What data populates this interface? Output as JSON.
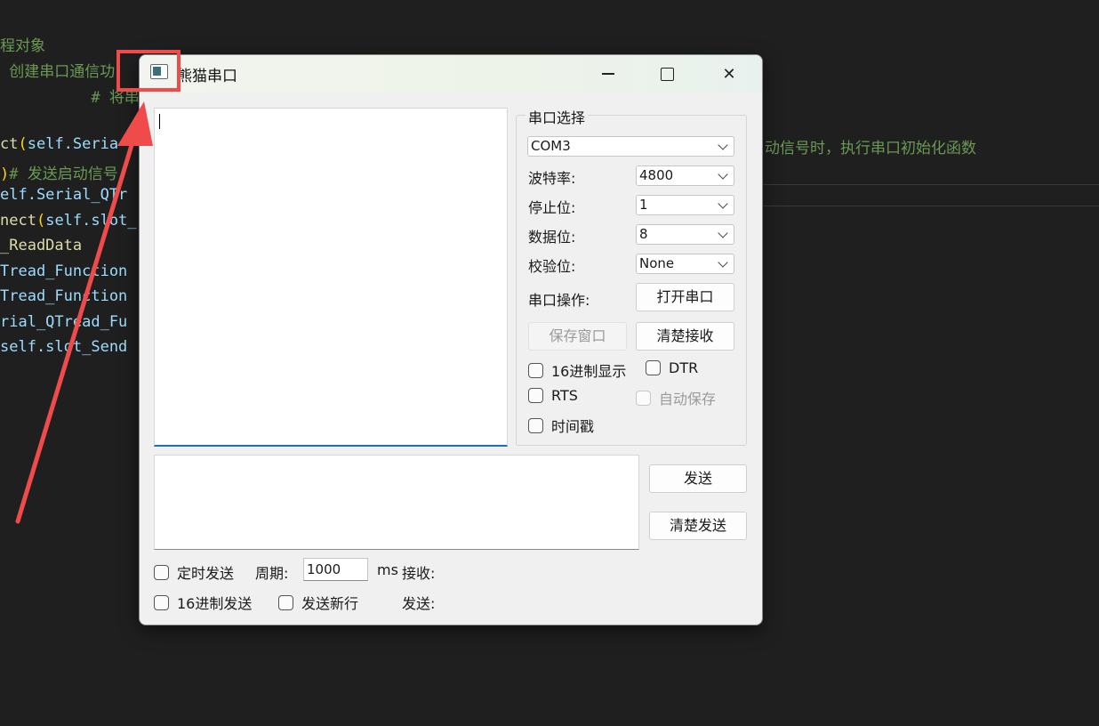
{
  "editor": {
    "lines": [
      {
        "segments": [
          {
            "cls": "c-comment",
            "text": "程对象"
          }
        ]
      },
      {
        "segments": [
          {
            "cls": "c-comment",
            "text": " 创建串口通信功"
          }
        ]
      },
      {
        "segments": [
          {
            "cls": "c-comment",
            "text": "          # 将串"
          }
        ]
      },
      {
        "segments": [
          {
            "cls": "c-func",
            "text": "ct"
          },
          {
            "cls": "c-paren",
            "text": "("
          },
          {
            "cls": "c-var",
            "text": "self.Seria"
          }
        ]
      },
      {
        "segments": [
          {
            "cls": "c-paren",
            "text": ")"
          },
          {
            "cls": "c-comment",
            "text": "# 发送启动信号"
          }
        ]
      },
      {
        "segments": [
          {
            "cls": "c-var",
            "text": "elf.Serial_QTr"
          }
        ]
      },
      {
        "segments": [
          {
            "cls": "c-func",
            "text": "nect"
          },
          {
            "cls": "c-paren",
            "text": "("
          },
          {
            "cls": "c-var",
            "text": "self.slot_"
          }
        ]
      },
      {
        "segments": [
          {
            "cls": "c-func",
            "text": "_ReadData"
          }
        ]
      },
      {
        "segments": [
          {
            "cls": "c-var",
            "text": "Tread_Function"
          }
        ]
      },
      {
        "segments": [
          {
            "cls": "c-var",
            "text": "Tread_Function"
          }
        ]
      },
      {
        "segments": [
          {
            "cls": "c-var",
            "text": "rial_QTread_Fu"
          }
        ]
      },
      {
        "segments": [
          {
            "cls": "c-var",
            "text": "self.slot_Send"
          }
        ]
      }
    ],
    "right_comment": "动信号时，执行串口初始化函数"
  },
  "window": {
    "title": "熊猫串口",
    "minimize_glyph": "—",
    "close_glyph": "✕"
  },
  "serial": {
    "group_title": "串口选择",
    "port": "COM3",
    "baud_label": "波特率:",
    "baud": "4800",
    "stop_label": "停止位:",
    "stop": "1",
    "data_label": "数据位:",
    "data": "8",
    "parity_label": "校验位:",
    "parity": "None",
    "op_label": "串口操作:",
    "open_button": "打开串口",
    "save_window_button": "保存窗口",
    "clear_recv_button": "清楚接收",
    "hex_display": "16进制显示",
    "dtr": "DTR",
    "rts": "RTS",
    "auto_save": "自动保存",
    "timestamp": "时间戳"
  },
  "send": {
    "send_button": "发送",
    "clear_send_button": "清楚发送",
    "timed_send": "定时发送",
    "period_label": "周期:",
    "period_value": "1000",
    "ms": "ms",
    "recv_count_label": "接收:",
    "hex_send": "16进制发送",
    "send_newline": "发送新行",
    "send_count_label": "发送:"
  },
  "colors": {
    "annotation": "#ef4b4b",
    "editor_bg": "#1f1f1f"
  }
}
